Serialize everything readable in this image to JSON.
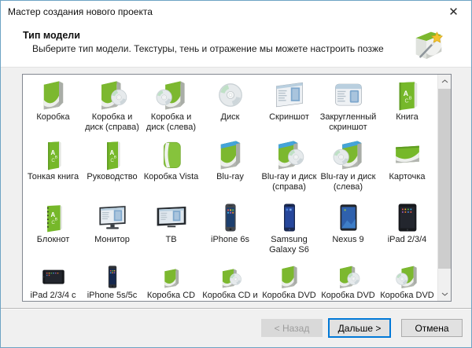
{
  "window": {
    "title": "Мастер создания нового проекта",
    "close_icon": "✕"
  },
  "header": {
    "title": "Тип модели",
    "subtitle": "Выберите тип модели. Текстуры, тень и отражение мы можете настроить позже",
    "wizard_icon": "box-with-magic-wand"
  },
  "model_grid": {
    "items": [
      {
        "label": "Коробка",
        "icon": "box"
      },
      {
        "label": "Коробка и диск (справа)",
        "icon": "box-disc-r"
      },
      {
        "label": "Коробка и диск (слева)",
        "icon": "box-disc-l"
      },
      {
        "label": "Диск",
        "icon": "disc"
      },
      {
        "label": "Скриншот",
        "icon": "screenshot"
      },
      {
        "label": "Закругленный скриншот",
        "icon": "screenshot-round"
      },
      {
        "label": "Книга",
        "icon": "book"
      },
      {
        "label": "Тонкая книга",
        "icon": "book-thin"
      },
      {
        "label": "Руководство",
        "icon": "book-thin"
      },
      {
        "label": "Коробка Vista",
        "icon": "vista"
      },
      {
        "label": "Blu-ray",
        "icon": "bluray"
      },
      {
        "label": "Blu-ray и диск (справа)",
        "icon": "bluray-disc-r"
      },
      {
        "label": "Blu-ray и диск (слева)",
        "icon": "bluray-disc-l"
      },
      {
        "label": "Карточка",
        "icon": "card"
      },
      {
        "label": "Блокнот",
        "icon": "notepad"
      },
      {
        "label": "Монитор",
        "icon": "monitor"
      },
      {
        "label": "ТВ",
        "icon": "tv"
      },
      {
        "label": "iPhone 6s",
        "icon": "phone6"
      },
      {
        "label": "Samsung Galaxy S6",
        "icon": "galaxy"
      },
      {
        "label": "Nexus 9",
        "icon": "nexus"
      },
      {
        "label": "iPad 2/3/4",
        "icon": "ipad"
      },
      {
        "label": "iPad 2/3/4 с",
        "icon": "ipad-land"
      },
      {
        "label": "iPhone 5s/5c",
        "icon": "phone5"
      },
      {
        "label": "Коробка CD",
        "icon": "cd-box"
      },
      {
        "label": "Коробка CD и",
        "icon": "cd-box-disc"
      },
      {
        "label": "Коробка DVD",
        "icon": "dvd-box"
      },
      {
        "label": "Коробка DVD и",
        "icon": "dvd-box-disc-r"
      },
      {
        "label": "Коробка DVD и",
        "icon": "dvd-box-disc-l"
      }
    ]
  },
  "scrollbar": {
    "up_icon": "chevron-up",
    "down_icon": "chevron-down",
    "state": "thumb-full"
  },
  "footer": {
    "back": "< Назад",
    "next": "Дальше >",
    "cancel": "Отмена",
    "back_enabled": false,
    "next_focused": true
  },
  "colors": {
    "accent_green": "#7cb82f",
    "focus_blue": "#0078d7",
    "dialog_border": "#6da3c4",
    "list_bg": "#ffffff",
    "body_bg": "#f0f0f0"
  }
}
